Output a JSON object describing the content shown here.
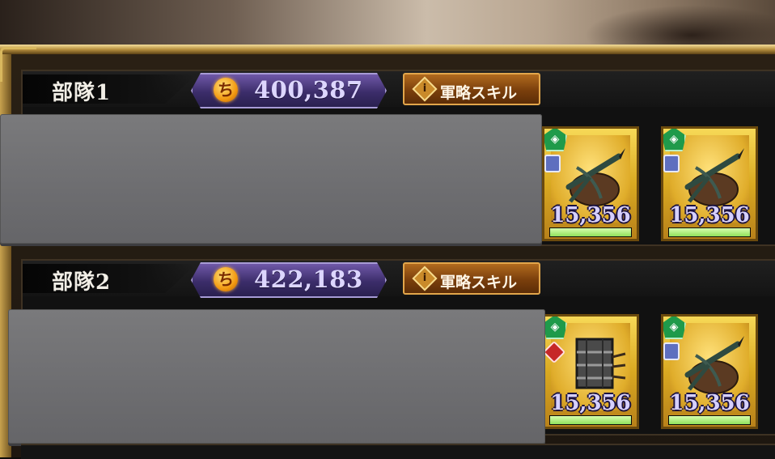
{
  "squads": [
    {
      "name": "部隊1",
      "power": "400,387",
      "power_icon": "flame-power-icon",
      "skill_button": {
        "label": "軍略スキル",
        "info_glyph": "i"
      },
      "units": [
        {
          "troops": "15,356",
          "weapon": "crossbow",
          "type_glyph": "◈",
          "hp_fraction": 1.0
        },
        {
          "troops": "15,356",
          "weapon": "crossbow",
          "type_glyph": "◈",
          "hp_fraction": 1.0
        }
      ]
    },
    {
      "name": "部隊2",
      "power": "422,183",
      "power_icon": "flame-power-icon",
      "skill_button": {
        "label": "軍略スキル",
        "info_glyph": "i"
      },
      "units": [
        {
          "troops": "15,356",
          "weapon": "spike-cart",
          "type_glyph": "◈",
          "hp_fraction": 1.0
        },
        {
          "troops": "15,356",
          "weapon": "crossbow",
          "type_glyph": "◈",
          "hp_fraction": 1.0
        }
      ]
    }
  ],
  "colors": {
    "power_badge": "#4b3a86",
    "skill_button": "#8a4a12",
    "unit_card_gold": "#e4b52e",
    "hp_fill": "#a6ec74",
    "redaction_gray": "#707073"
  }
}
